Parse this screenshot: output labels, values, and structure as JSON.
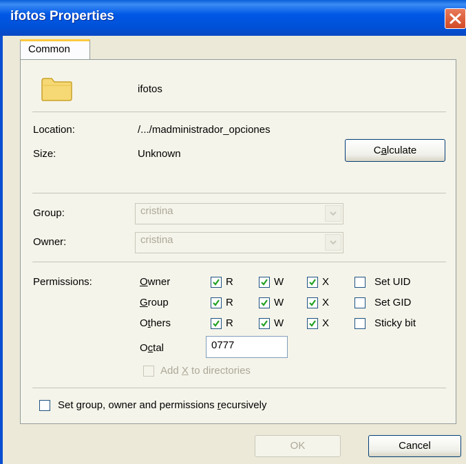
{
  "window": {
    "title": "ifotos Properties"
  },
  "tabs": [
    {
      "label": "Common"
    }
  ],
  "file": {
    "name": "ifotos"
  },
  "info": {
    "location_label": "Location:",
    "location_value": "/.../madministrador_opciones",
    "size_label": "Size:",
    "size_value": "Unknown",
    "calculate": {
      "pre": "C",
      "key": "a",
      "post": "lculate"
    }
  },
  "ownership": {
    "group_label": "Group:",
    "group_value": "cristina",
    "owner_label": "Owner:",
    "owner_value": "cristina"
  },
  "permissions": {
    "label": "Permissions:",
    "rows": [
      {
        "key": "O",
        "rest": "wner",
        "pre": "",
        "r": true,
        "w": true,
        "x": true,
        "special": "Set UID",
        "special_checked": false
      },
      {
        "key": "G",
        "rest": "roup",
        "pre": "",
        "r": true,
        "w": true,
        "x": true,
        "special": "Set GID",
        "special_checked": false
      },
      {
        "key": "t",
        "rest": "hers",
        "pre": "O",
        "r": true,
        "w": true,
        "x": true,
        "special": "Sticky bit",
        "special_checked": false
      }
    ],
    "r_label": "R",
    "w_label": "W",
    "x_label": "X",
    "octal": {
      "pre": "O",
      "key": "c",
      "post": "tal",
      "value": "0777"
    },
    "add_x": {
      "pre": "Add ",
      "key": "X",
      "post": " to directories",
      "checked": false,
      "enabled": false
    }
  },
  "recursive": {
    "pre": "Set group, owner and permissions ",
    "key": "r",
    "post": "ecursively",
    "checked": false
  },
  "buttons": {
    "ok": "OK",
    "cancel": "Cancel"
  },
  "colors": {
    "titlebar": "#0058e6",
    "face": "#ece9d8",
    "panel": "#f5f4ea",
    "check": "#21a121",
    "close": "#d24a25"
  }
}
